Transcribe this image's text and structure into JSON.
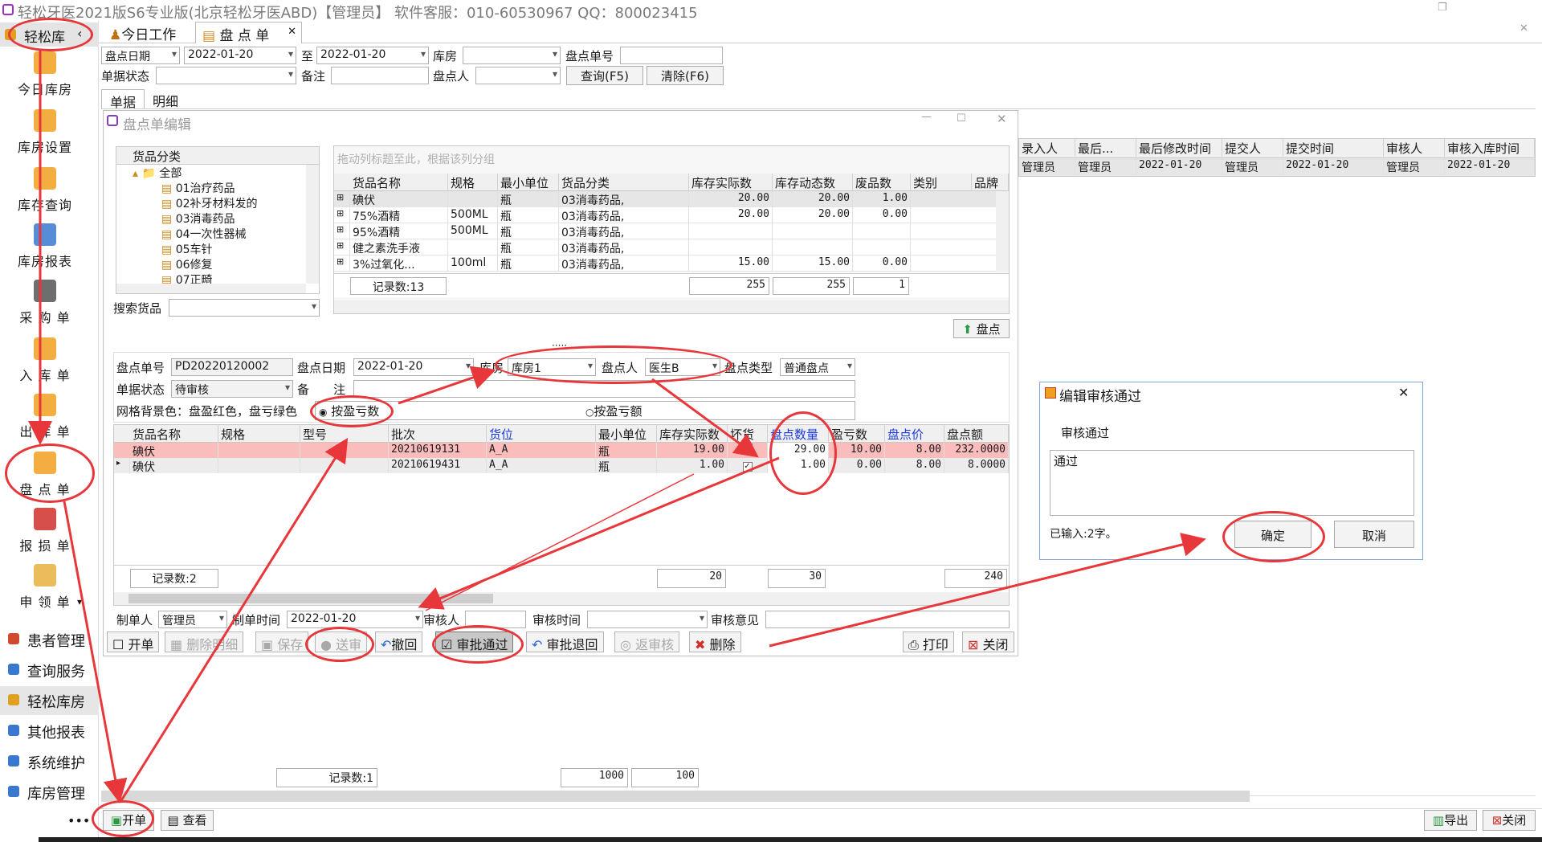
{
  "window": {
    "title": "轻松牙医2021版S6专业版(北京轻松牙医ABD)【管理员】    软件客服：010-60530967 QQ：800023415"
  },
  "sidebar": {
    "header": "轻松库",
    "items": [
      {
        "label": "今日库房",
        "icon": "box-icon",
        "color": "#f0a020"
      },
      {
        "label": "库房设置",
        "icon": "box-gear-icon",
        "color": "#f0a020"
      },
      {
        "label": "库存查询",
        "icon": "boxes-icon",
        "color": "#f0a020"
      },
      {
        "label": "库房报表",
        "icon": "report-chart-icon",
        "color": "#3a78d0"
      },
      {
        "label": "采 购 单",
        "icon": "cart-icon",
        "color": "#555555"
      },
      {
        "label": "入 库 单",
        "icon": "inbound-box-icon",
        "color": "#f0a020"
      },
      {
        "label": "出 库 单",
        "icon": "outbound-box-icon",
        "color": "#f0a020"
      },
      {
        "label": "盘 点 单",
        "icon": "inventory-check-icon",
        "color": "#f0a020"
      },
      {
        "label": "报 损 单",
        "icon": "clipboard-icon",
        "color": "#d0302a"
      },
      {
        "label": "申 领 单",
        "icon": "hand-icon",
        "color": "#e8b040"
      }
    ],
    "groups": [
      "患者管理",
      "查询服务",
      "轻松库房",
      "其他报表",
      "系统维护",
      "库房管理"
    ]
  },
  "tabs": [
    "今日工作",
    "盘 点 单"
  ],
  "filter": {
    "date_type": "盘点日期",
    "date_from": "2022-01-20",
    "to_label": "至",
    "date_to": "2022-01-20",
    "warehouse_label": "库房",
    "warehouse_value": "",
    "doc_no_label": "盘点单号",
    "doc_no_value": "",
    "status_label": "单据状态",
    "status_value": "",
    "note_label": "备注",
    "note_value": "",
    "counter_label": "盘点人",
    "counter_value": "",
    "query_btn": "查询(F5)",
    "clear_btn": "清除(F6)"
  },
  "subtabs": [
    "单据",
    "明细"
  ],
  "list_grid": {
    "headers": [
      "录入人",
      "最后...",
      "最后修改时间",
      "提交人",
      "提交时间",
      "审核人",
      "审核入库时间"
    ],
    "row": [
      "管理员",
      "管理员",
      "2022-01-20",
      "管理员",
      "2022-01-20",
      "管理员",
      "2022-01-20"
    ],
    "footer_count": "记录数:1",
    "footer_values": [
      "1000",
      "100"
    ]
  },
  "edit": {
    "title": "盘点单编辑",
    "category_header": "货品分类",
    "tree": [
      "全部",
      "01治疗药品",
      "02补牙材料发的",
      "03消毒药品",
      "04一次性器械",
      "05车针",
      "06修复",
      "07正畸"
    ],
    "search_label": "搜索货品",
    "group_hint": "拖动列标题至此，根据该列分组",
    "goods_headers": [
      "货品名称",
      "规格",
      "最小单位",
      "货品分类",
      "库存实际数",
      "库存动态数",
      "废品数",
      "类别",
      "品牌"
    ],
    "goods_rows": [
      [
        "碘伏",
        "",
        "瓶",
        "03消毒药品,",
        "20.00",
        "20.00",
        "1.00"
      ],
      [
        "75%酒精",
        "500ML",
        "瓶",
        "03消毒药品,",
        "20.00",
        "20.00",
        "0.00"
      ],
      [
        "95%酒精",
        "500ML",
        "瓶",
        "03消毒药品,",
        "",
        "",
        ""
      ],
      [
        "健之素洗手液",
        "",
        "瓶",
        "03消毒药品,",
        "",
        "",
        ""
      ],
      [
        "3%过氧化...",
        "100ml",
        "瓶",
        "03消毒药品,",
        "15.00",
        "15.00",
        "0.00"
      ]
    ],
    "goods_footer": {
      "count": "记录数:13",
      "s1": "255",
      "s2": "255",
      "s3": "1"
    },
    "count_btn": "盘点",
    "form": {
      "doc_no_label": "盘点单号",
      "doc_no": "PD20220120002",
      "date_label": "盘点日期",
      "date": "2022-01-20",
      "warehouse_label": "库房",
      "warehouse": "库房1",
      "counter_label": "盘点人",
      "counter": "医生B",
      "type_label": "盘点类型",
      "type": "普通盘点",
      "status_label": "单据状态",
      "status": "待审核",
      "note_label": "备　　注",
      "bg_label": "网格背景色：盘盈红色，盘亏绿色",
      "radio1": "按盈亏数",
      "radio2": "按盈亏额"
    },
    "detail_headers": [
      "货品名称",
      "规格",
      "型号",
      "批次",
      "货位",
      "最小单位",
      "库存实际数",
      "坏货",
      "盘点数量",
      "盈亏数",
      "盘点价",
      "盘点额"
    ],
    "detail_rows": [
      {
        "name": "碘伏",
        "spec": "",
        "model": "",
        "batch": "20210619131",
        "loc": "A_A",
        "unit": "瓶",
        "stock": "19.00",
        "bad": false,
        "qty": "29.00",
        "diff": "10.00",
        "price": "8.00",
        "amount": "232.0000"
      },
      {
        "name": "碘伏",
        "spec": "",
        "model": "",
        "batch": "20210619431",
        "loc": "A_A",
        "unit": "瓶",
        "stock": "1.00",
        "bad": true,
        "qty": "1.00",
        "diff": "0.00",
        "price": "8.00",
        "amount": "8.0000"
      }
    ],
    "detail_footer": {
      "count": "记录数:2",
      "stock": "20",
      "qty": "30",
      "amount": "240"
    },
    "maker_label": "制单人",
    "maker": "管理员",
    "make_time_label": "制单时间",
    "make_time": "2022-01-20",
    "auditor_label": "审核人",
    "auditor": "",
    "audit_time_label": "审核时间",
    "audit_time": "",
    "audit_opinion_label": "审核意见",
    "buttons": [
      "开单",
      "删除明细",
      "保存",
      "送审",
      "撤回",
      "审批通过",
      "审批退回",
      "返审核",
      "删除",
      "打印",
      "关闭"
    ]
  },
  "dialog": {
    "title": "编辑审核通过",
    "label": "审核通过",
    "text": "通过",
    "counter": "已输入:2字。",
    "ok": "确定",
    "cancel": "取消"
  },
  "bottom": {
    "new_btn": "开单",
    "view_btn": "查看",
    "export_btn": "导出",
    "close_btn": "关闭"
  }
}
